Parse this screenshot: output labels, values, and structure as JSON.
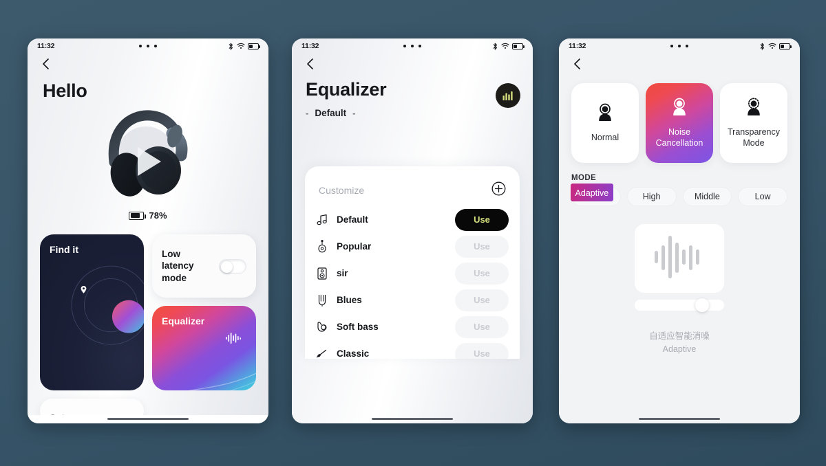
{
  "background_color": "#3a5769",
  "status_bar": {
    "time": "11:32",
    "icons": [
      "bluetooth-icon",
      "wifi-icon",
      "battery-icon"
    ]
  },
  "phone1": {
    "back_icon": "back-chevron-icon",
    "title": "Hello",
    "product_image": "headphones-image",
    "battery": {
      "icon": "battery-icon",
      "percent": "78%"
    },
    "cards": {
      "low_latency": {
        "label": "Low latency mode",
        "toggle": "off",
        "toggle_name": "low-latency-toggle"
      },
      "find_it": {
        "label": "Find it",
        "icon": "location-pin-icon"
      },
      "equalizer": {
        "label": "Equalizer",
        "icon": "equalizer-wave-icon"
      },
      "set_up": {
        "label": "Set up"
      }
    },
    "home_indicator": "home-indicator"
  },
  "phone2": {
    "back_icon": "back-chevron-icon",
    "title": "Equalizer",
    "subtitle": "Default",
    "subtitle_dash_left": "-",
    "subtitle_dash_right": "-",
    "badge_icon": "equalizer-bars-icon",
    "badge_color": "#1d1c18",
    "badge_bar_color": "#d5de7d",
    "panel": {
      "customize_label": "Customize",
      "add_icon": "plus-circle-icon",
      "presets": [
        {
          "icon": "music-note-icon",
          "name": "Default",
          "button": "Use",
          "active": true
        },
        {
          "icon": "guitar-icon",
          "name": "Popular",
          "button": "Use",
          "active": false
        },
        {
          "icon": "speaker-icon",
          "name": "sir",
          "button": "Use",
          "active": false
        },
        {
          "icon": "guitar-neck-icon",
          "name": "Blues",
          "button": "Use",
          "active": false
        },
        {
          "icon": "hand-drum-icon",
          "name": "Soft bass",
          "button": "Use",
          "active": false
        },
        {
          "icon": "violin-icon",
          "name": "Classic",
          "button": "Use",
          "active": false
        }
      ]
    }
  },
  "phone3": {
    "back_icon": "back-chevron-icon",
    "mode_cards": [
      {
        "icon": "person-normal-icon",
        "label": "Normal",
        "active": false
      },
      {
        "icon": "person-noise-cancel-icon",
        "label": "Noise Cancellation",
        "active": true
      },
      {
        "icon": "person-transparency-icon",
        "label": "Transparency Mode",
        "active": false
      }
    ],
    "mode_section_title": "MODE",
    "chips": [
      {
        "label": "Adaptive",
        "active": true
      },
      {
        "label": "High",
        "active": false
      },
      {
        "label": "Middle",
        "active": false
      },
      {
        "label": "Low",
        "active": false
      }
    ],
    "visualizer_icon": "audio-waveform-icon",
    "slider_name": "intensity-slider",
    "caption_cn": "自适应智能消噪",
    "caption_en": "Adaptive"
  }
}
